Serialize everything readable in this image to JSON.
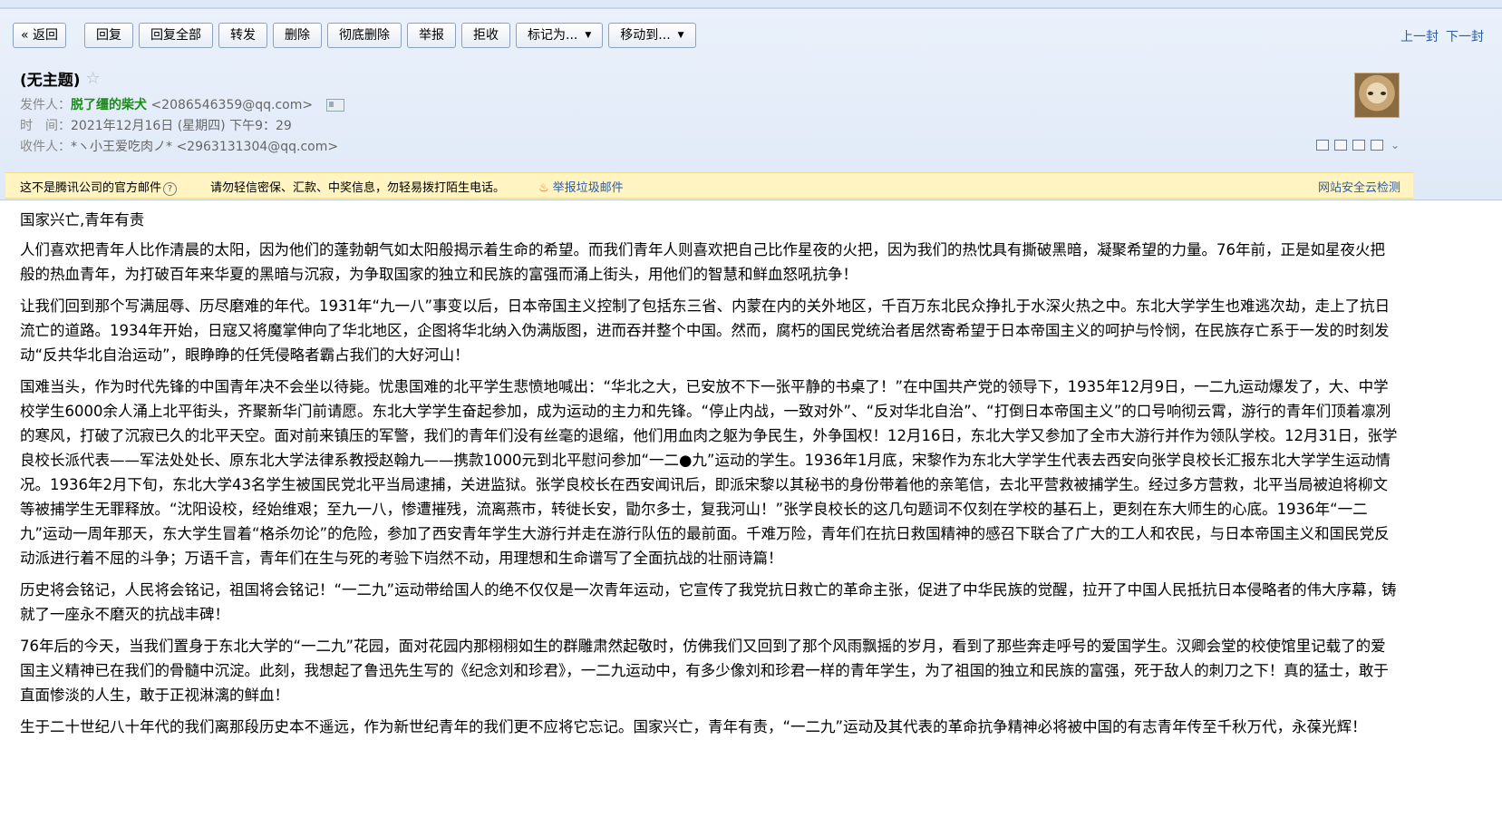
{
  "toolbar": {
    "back": "« 返回",
    "reply": "回复",
    "reply_all": "回复全部",
    "forward": "转发",
    "delete": "删除",
    "delete_perm": "彻底删除",
    "report": "举报",
    "reject": "拒收",
    "mark_as": "标记为...",
    "move_to": "移动到...",
    "prev": "上一封",
    "next": "下一封"
  },
  "mail": {
    "subject": "(无主题)",
    "from_label": "发件人：",
    "from_name": "脱了缰的柴犬",
    "from_addr": "<2086546359@qq.com>",
    "time_label": "时　间：",
    "time": "2021年12月16日 (星期四) 下午9：29",
    "to_label": "收件人：",
    "to_name": "*ヽ小王爱吃肉ノ*",
    "to_addr": "<2963131304@qq.com>"
  },
  "warning": {
    "text1": "这不是腾讯公司的官方邮件",
    "help": "?",
    "text2": "请勿轻信密保、汇款、中奖信息，勿轻易拨打陌生电话。",
    "report": "举报垃圾邮件",
    "safe_check": "网站安全云检测"
  },
  "body": {
    "title": "国家兴亡,青年有责",
    "paragraphs": [
      "人们喜欢把青年人比作清晨的太阳，因为他们的蓬勃朝气如太阳般揭示着生命的希望。而我们青年人则喜欢把自己比作星夜的火把，因为我们的热忱具有撕破黑暗，凝聚希望的力量。76年前，正是如星夜火把般的热血青年，为打破百年来华夏的黑暗与沉寂，为争取国家的独立和民族的富强而涌上街头，用他们的智慧和鲜血怒吼抗争！",
      "让我们回到那个写满屈辱、历尽磨难的年代。1931年“九一八”事变以后，日本帝国主义控制了包括东三省、内蒙在内的关外地区，千百万东北民众挣扎于水深火热之中。东北大学学生也难逃次劫，走上了抗日流亡的道路。1934年开始，日寇又将魔掌伸向了华北地区，企图将华北纳入伪满版图，进而吞并整个中国。然而，腐朽的国民党统治者居然寄希望于日本帝国主义的呵护与怜悯，在民族存亡系于一发的时刻发动“反共华北自治运动”，眼睁睁的任凭侵略者霸占我们的大好河山！",
      "国难当头，作为时代先锋的中国青年决不会坐以待毙。忧患国难的北平学生悲愤地喊出：“华北之大，已安放不下一张平静的书桌了！”在中国共产党的领导下，1935年12月9日，一二九运动爆发了，大、中学校学生6000余人涌上北平街头，齐聚新华门前请愿。东北大学学生奋起参加，成为运动的主力和先锋。“停止内战，一致对外”、“反对华北自治”、“打倒日本帝国主义”的口号响彻云霄，游行的青年们顶着凛冽的寒风，打破了沉寂已久的北平天空。面对前来镇压的军警，我们的青年们没有丝毫的退缩，他们用血肉之躯为争民生，外争国权！12月16日，东北大学又参加了全市大游行并作为领队学校。12月31日，张学良校长派代表——军法处处长、原东北大学法律系教授赵翰九——携款1000元到北平慰问参加“一二●九”运动的学生。1936年1月底，宋黎作为东北大学学生代表去西安向张学良校长汇报东北大学学生运动情况。1936年2月下旬，东北大学43名学生被国民党北平当局逮捕，关进监狱。张学良校长在西安闻讯后，即派宋黎以其秘书的身份带着他的亲笔信，去北平营救被捕学生。经过多方营救，北平当局被迫将柳文等被捕学生无罪释放。“沈阳设校，经始维艰；至九一八，惨遭摧残，流离燕市，转徙长安，勖尔多士，复我河山！”张学良校长的这几句题词不仅刻在学校的基石上，更刻在东大师生的心底。1936年“一二九”运动一周年那天，东大学生冒着“格杀勿论”的危险，参加了西安青年学生大游行并走在游行队伍的最前面。千难万险，青年们在抗日救国精神的感召下联合了广大的工人和农民，与日本帝国主义和国民党反动派进行着不屈的斗争；万语千言，青年们在生与死的考验下岿然不动，用理想和生命谱写了全面抗战的壮丽诗篇！",
      "历史将会铭记，人民将会铭记，祖国将会铭记！“一二九”运动带给国人的绝不仅仅是一次青年运动，它宣传了我党抗日救亡的革命主张，促进了中华民族的觉醒，拉开了中国人民抵抗日本侵略者的伟大序幕，铸就了一座永不磨灭的抗战丰碑！",
      "76年后的今天，当我们置身于东北大学的“一二九”花园，面对花园内那栩栩如生的群雕肃然起敬时，仿佛我们又回到了那个风雨飘摇的岁月，看到了那些奔走呼号的爱国学生。汉卿会堂的校使馆里记载了的爱国主义精神已在我们的骨髓中沉淀。此刻，我想起了鲁迅先生写的《纪念刘和珍君》，一二九运动中，有多少像刘和珍君一样的青年学生，为了祖国的独立和民族的富强，死于敌人的刺刀之下！真的猛士，敢于直面惨淡的人生，敢于正视淋漓的鲜血！",
      "生于二十世纪八十年代的我们离那段历史本不遥远，作为新世纪青年的我们更不应将它忘记。国家兴亡，青年有责，“一二九”运动及其代表的革命抗争精神必将被中国的有志青年传至千秋万代，永葆光辉！"
    ]
  }
}
